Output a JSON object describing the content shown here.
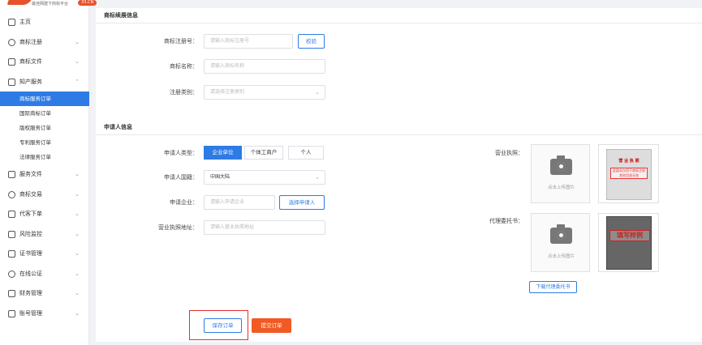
{
  "logo": {
    "slogan": "最佳网建下商标平台",
    "badge": "33.CN"
  },
  "sidebar": {
    "items": [
      {
        "label": "主页",
        "icon": "home-icon"
      },
      {
        "label": "商标注册",
        "icon": "registration-icon",
        "chevron": "⌄"
      },
      {
        "label": "商标文件",
        "icon": "file-icon",
        "chevron": "⌄"
      },
      {
        "label": "知产服务",
        "icon": "ip-service-icon",
        "chevron": "⌃"
      }
    ],
    "subitems": [
      "商标服务订单",
      "国际商标订单",
      "版权服务订单",
      "专利服务订单",
      "法律服务订单"
    ],
    "items2": [
      {
        "label": "服务文件",
        "icon": "service-file-icon",
        "chevron": "⌄"
      },
      {
        "label": "商标交易",
        "icon": "trade-icon",
        "chevron": "⌄"
      },
      {
        "label": "代客下单",
        "icon": "proxy-order-icon",
        "chevron": "⌄"
      },
      {
        "label": "风险监控",
        "icon": "monitor-icon",
        "chevron": "⌄"
      },
      {
        "label": "证书管理",
        "icon": "certificate-icon",
        "chevron": "⌄"
      },
      {
        "label": "在线公证",
        "icon": "notary-icon",
        "chevron": "⌄"
      },
      {
        "label": "财务管理",
        "icon": "finance-icon",
        "chevron": "⌄"
      },
      {
        "label": "账号管理",
        "icon": "account-icon",
        "chevron": "⌄"
      }
    ]
  },
  "trademark": {
    "section_title": "商标续展信息",
    "reg_no_label": "商标注册号：",
    "reg_no_placeholder": "请输入商标注册号",
    "verify_button": "校验",
    "name_label": "商标名称：",
    "name_placeholder": "请输入商标名称",
    "category_label": "注册类别：",
    "category_placeholder": "请选择注册类别",
    "dropdown_glyph": "⌄"
  },
  "applicant": {
    "section_title": "申请人信息",
    "type_label": "申请人类型：",
    "type_options": [
      "企业单位",
      "个体工商户",
      "个人"
    ],
    "country_label": "申请人国籍：",
    "country_value": "中国大陆",
    "company_label": "申请企业：",
    "company_placeholder": "请输入申请企业",
    "select_applicant_button": "选择申请人",
    "address_label": "营业执照地址：",
    "address_placeholder": "请输入营业执照地址",
    "license_label": "营业执照：",
    "license_upload_hint": "点击上传图片",
    "license_sample": {
      "title": "营 业 执 照",
      "stamp": "此副本仅用于商标注册 其他用途无效"
    },
    "power_label": "代理委托书：",
    "power_upload_hint": "点击上传图片",
    "power_sample": {
      "watermark": "填写样例"
    },
    "download_power_button": "下载代理委托书"
  },
  "actions": {
    "save": "保存订单",
    "submit": "提交订单"
  },
  "colors": {
    "accent": "#2e7be6",
    "brand": "#f15a24",
    "highlight": "#e62e2e"
  }
}
